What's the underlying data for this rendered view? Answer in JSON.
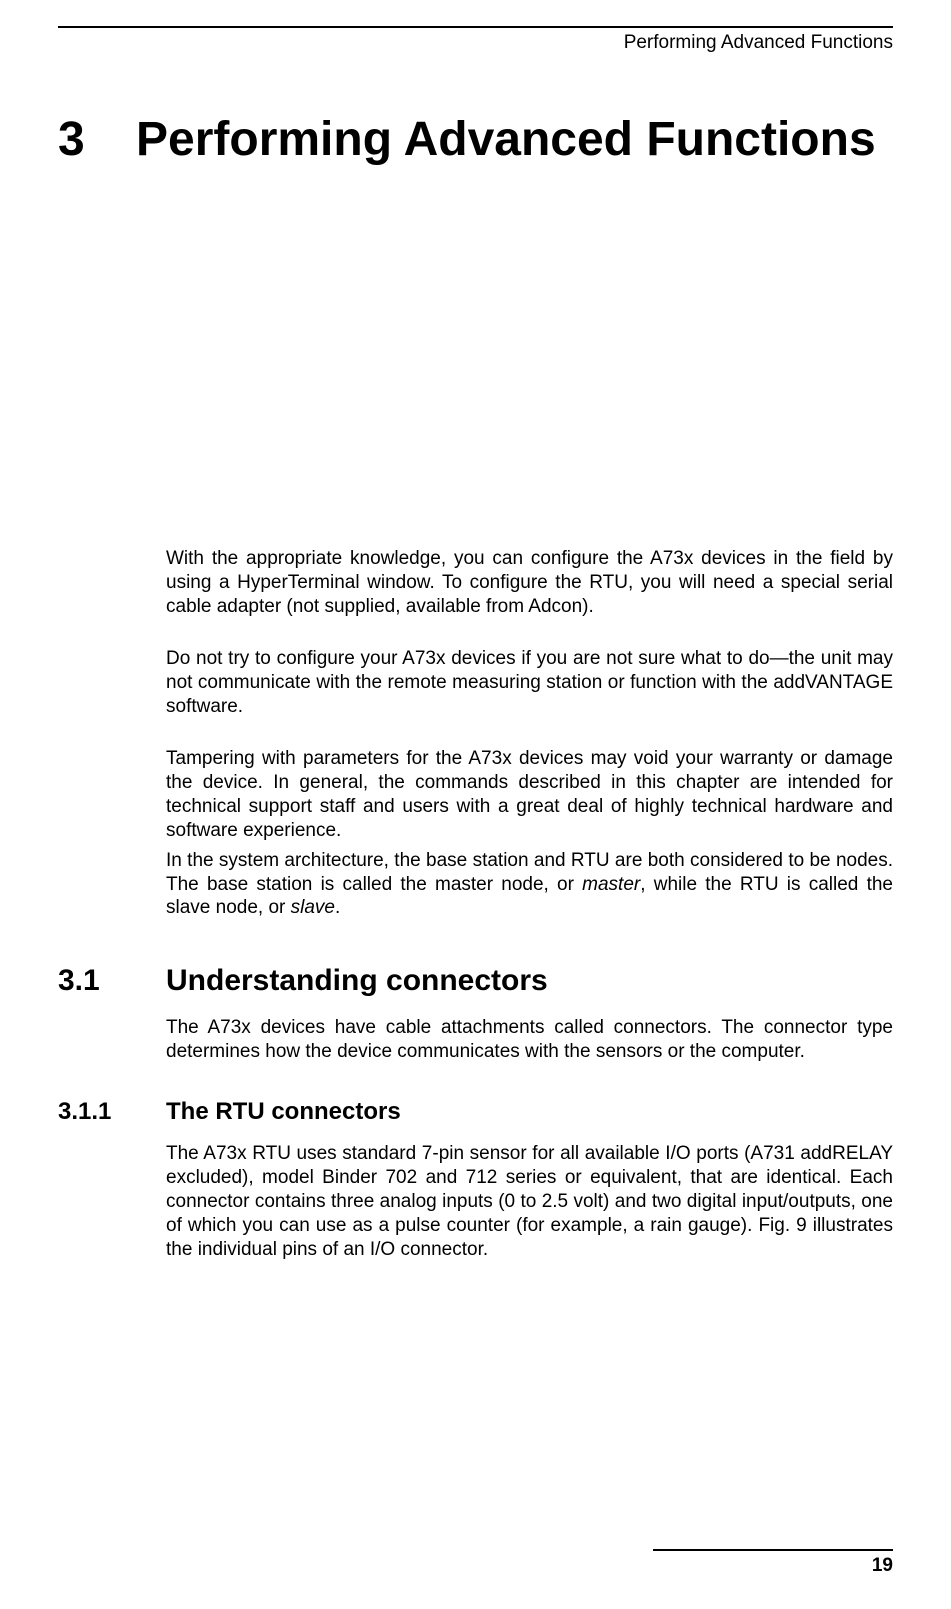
{
  "header": {
    "running_title": "Performing Advanced Functions"
  },
  "chapter": {
    "number": "3",
    "title": "Performing Advanced Functions"
  },
  "paragraphs": {
    "p1": "With the appropriate knowledge, you can configure the A73x devices in the field by using a HyperTerminal window. To configure the RTU, you will need a special serial cable adapter (not supplied, available from Adcon).",
    "p2": "Do not try to configure your A73x devices if you are not sure what to do—the unit may not communicate with the remote measuring station or function with the addVANTAGE software.",
    "p3": "Tampering with parameters for the A73x devices may void your warranty or damage the device. In general, the commands described in this chapter are intended for technical support staff and users with a great deal of highly technical hardware and software experience.",
    "p4_a": "In the system architecture, the base station and RTU are both considered to be nodes. The base station is called the master node, or ",
    "p4_b": "master",
    "p4_c": ", while the RTU is called the slave node, or ",
    "p4_d": "slave",
    "p4_e": "."
  },
  "section_3_1": {
    "number": "3.1",
    "title": "Understanding connectors",
    "p1": "The A73x devices have cable attachments called connectors. The connector type determines how the device communicates with the sensors or the computer."
  },
  "section_3_1_1": {
    "number": "3.1.1",
    "title": "The RTU connectors",
    "p1": "The A73x RTU uses standard 7-pin sensor for all available I/O ports (A731 addRELAY excluded), model Binder 702 and 712 series or equivalent, that are identical. Each connector contains three analog inputs (0 to 2.5 volt) and two digital input/outputs, one of which you can use as a pulse counter (for example, a rain gauge). Fig. 9 illustrates the individual pins of an I/O connector."
  },
  "footer": {
    "page_number": "19"
  }
}
